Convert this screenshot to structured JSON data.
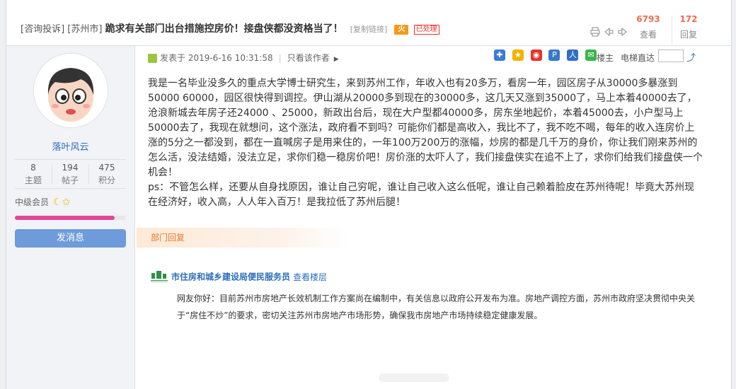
{
  "thread": {
    "category": "[咨询投诉]",
    "city": "[苏州市]",
    "title": "跪求有关部门出台措施控房价！接盘侠都没资格当了！",
    "copy_link": "[复制链接]",
    "fire_label": "火",
    "status": "已处理",
    "views": "6793",
    "views_label": "查看",
    "replies": "172",
    "replies_label": "回复"
  },
  "author": {
    "name": "落叶风云",
    "stats": [
      {
        "value": "8",
        "label": "主题"
      },
      {
        "value": "194",
        "label": "帖子"
      },
      {
        "value": "475",
        "label": "积分"
      }
    ],
    "rank": "中级会员",
    "level_progress": 0.9,
    "message_button": "发消息"
  },
  "post": {
    "posted": "发表于 2019-6-16 10:31:58",
    "only_author": "只看该作者",
    "floor": "楼主",
    "jump_label": "电梯直达",
    "paragraphs": [
      "我是一名毕业没多久的重点大学博士研究生，来到苏州工作，年收入也有20多万，看房一年，园区房子从30000多暴涨到50000  60000，园区很快得到调控。伊山湖从20000多到现在的30000多，这几天又涨到35000了，马上本着40000去了，沧浪新城去年房子还24000 、25000，新政出台后，现在大户型都40000多，房东坐地起价，本着45000去，小户型马上50000去了，我现在就想问，这个涨法，政府看不到吗？可能你们都是高收入，我比不了，我不吃不喝，每年的收入连房价上涨的5分之一都没到，都在一直喊房子是用来住的，一年100万200万的涨幅，炒房的都是几千万的身价，你让我们刚来苏州的怎么活，没法结婚，没法立足，求你们稳一稳房价吧！房价涨的太吓人了，我们接盘侠实在追不上了，求你们给我们接盘侠一个机会！",
      "ps：不管怎么样，还要从自身找原因，谁让自己穷呢，谁让自己收入这么低呢，谁让自己赖着脸皮在苏州待呢！毕竟大苏州现在经济好，收入高，人人年入百万！是我拉低了苏州后腿！"
    ]
  },
  "reply": {
    "tag": "部门回复",
    "org": "市住房和城乡建设局便民服务员",
    "view_floor": "查看楼层",
    "text": "网友你好：目前苏州市房地产长效机制工作方案尚在编制中，有关信息以政府公开发布为准。房地产调控方面，苏州市政府坚决贯彻中央关于“房住不炒”的要求，密切关注苏州市房地产市场形势，确保我市房地产市场持续稳定健康发展。"
  },
  "colors": {
    "link": "#2a6ebb",
    "accent": "#f26c4f",
    "button": "#6e9bd9",
    "level_bar": "#e0489a"
  }
}
